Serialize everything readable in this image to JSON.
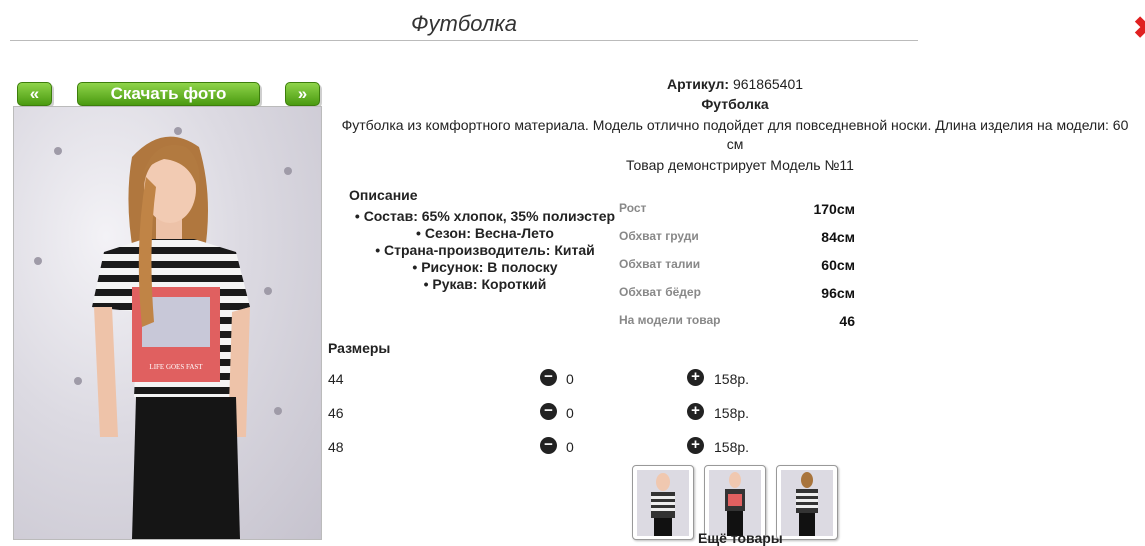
{
  "page": {
    "title": "Футболка",
    "close_icon": "close-icon"
  },
  "gallery": {
    "prev_label": "«",
    "download_label": "Скачать фото",
    "next_label": "»",
    "accent": "#5aaa1c"
  },
  "product": {
    "article_label": "Артикул:",
    "article_value": "961865401",
    "name": "Футболка",
    "description": "Футболка из комфортного материала. Модель отлично подойдет для повседневной носки. Длина изделия на модели: 60 см",
    "model_text": "Товар демонстрирует Модель №11"
  },
  "details": {
    "title": "Описание",
    "items": [
      "Состав: 65% хлопок, 35% полиэстер",
      "Сезон: Весна-Лето",
      "Страна-производитель: Китай",
      "Рисунок: В полоску",
      "Рукав: Короткий"
    ]
  },
  "measurements": [
    {
      "label": "Рост",
      "value": "170см"
    },
    {
      "label": "Обхват груди",
      "value": "84см"
    },
    {
      "label": "Обхват талии",
      "value": "60см"
    },
    {
      "label": "Обхват бёдер",
      "value": "96см"
    },
    {
      "label": "На модели товар",
      "value": "46"
    }
  ],
  "sizes": {
    "title": "Размеры",
    "rows": [
      {
        "size": "44",
        "qty": "0",
        "price": "158р."
      },
      {
        "size": "46",
        "qty": "0",
        "price": "158р."
      },
      {
        "size": "48",
        "qty": "0",
        "price": "158р."
      }
    ],
    "minus_icon": "minus-circle-icon",
    "plus_icon": "plus-circle-icon"
  },
  "more_label": "Ещё товары"
}
